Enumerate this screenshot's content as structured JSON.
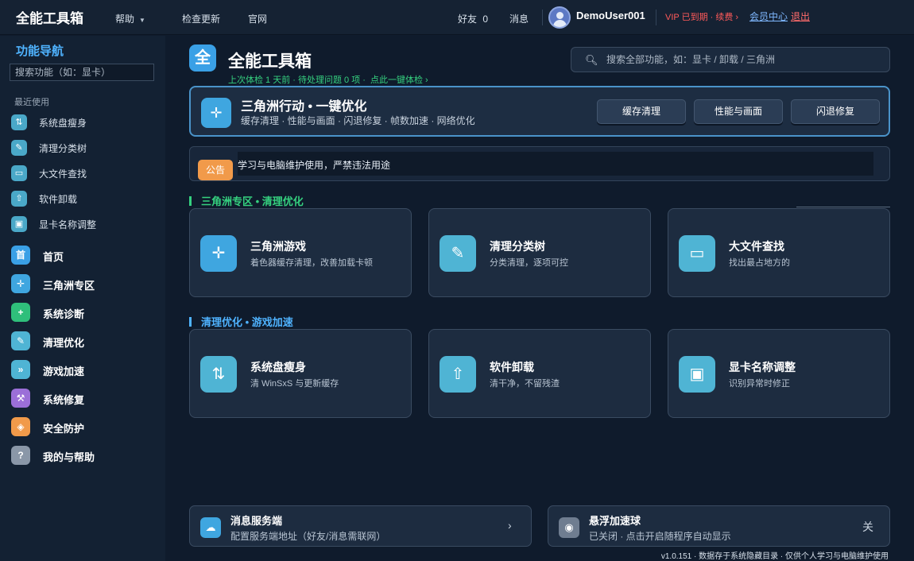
{
  "topbar": {
    "app_title": "全能工具箱",
    "menu_help": "帮助",
    "menu_check_update": "检查更新",
    "menu_official_site": "官网",
    "friends_label": "好友",
    "friends_count": "0",
    "messages_label": "消息",
    "username": "DemoUser001",
    "vip_status": "VIP 已到期 · 续费 ›",
    "member_center": "会员中心",
    "logout": "退出"
  },
  "sidebar": {
    "nav_title": "功能导航",
    "search_placeholder": "搜索功能（如：显卡）",
    "recent_label": "最近使用",
    "recent_items": [
      {
        "label": "系统盘瘦身",
        "icon": "usb-icon"
      },
      {
        "label": "清理分类树",
        "icon": "broom-icon"
      },
      {
        "label": "大文件查找",
        "icon": "folder-icon"
      },
      {
        "label": "软件卸载",
        "icon": "upload-icon"
      },
      {
        "label": "显卡名称调整",
        "icon": "gpu-icon"
      }
    ],
    "main_items": [
      {
        "label": "首页",
        "icon_text": "首",
        "color": "#3aa0e6"
      },
      {
        "label": "三角洲专区",
        "icon": "crosshair-icon",
        "color": "#3fa6e0"
      },
      {
        "label": "系统诊断",
        "icon": "plus-icon",
        "color": "#2fbf7b"
      },
      {
        "label": "清理优化",
        "icon": "broom-icon",
        "color": "#4fb4d4"
      },
      {
        "label": "游戏加速",
        "icon": "fast-forward-icon",
        "color": "#4fb4d4"
      },
      {
        "label": "系统修复",
        "icon": "wrench-icon",
        "color": "#9b6fd8"
      },
      {
        "label": "安全防护",
        "icon": "shield-icon",
        "color": "#f19a4a"
      },
      {
        "label": "我的与帮助",
        "icon": "question-icon",
        "color": "#8a97a8"
      }
    ]
  },
  "header": {
    "logo_text": "全",
    "title": "全能工具箱",
    "last_check": "上次体检 1 天前 · 待处理问题 0 项 ·",
    "check_action": "点此一键体检 ›",
    "search_placeholder": "搜索全部功能，如：显卡 / 卸载 / 三角洲"
  },
  "promo": {
    "title": "三角洲行动 • 一键优化",
    "desc": "缓存清理 · 性能与画面 · 闪退修复 · 帧数加速 · 网络优化",
    "buttons": [
      "缓存清理",
      "性能与画面",
      "闪退修复"
    ]
  },
  "notice": {
    "badge": "公告",
    "text": "学习与电脑维护使用，严禁违法用途"
  },
  "sections": [
    {
      "title": "三角洲专区 • 清理优化",
      "color": "#35d07f",
      "cards": [
        {
          "title": "三角洲游戏",
          "desc": "着色器缓存清理，改善加载卡顿",
          "icon": "crosshair-icon",
          "color": "#3fa6e0"
        },
        {
          "title": "清理分类树",
          "desc": "分类清理，逐项可控",
          "icon": "broom-icon",
          "color": "#4fb4d4"
        },
        {
          "title": "大文件查找",
          "desc": "找出最占地方的",
          "icon": "folder-icon",
          "color": "#4fb4d4"
        }
      ]
    },
    {
      "title": "清理优化 • 游戏加速",
      "color": "#4fb3ff",
      "cards": [
        {
          "title": "系统盘瘦身",
          "desc": "清 WinSxS 与更新缓存",
          "icon": "usb-icon",
          "color": "#4fb4d4"
        },
        {
          "title": "软件卸载",
          "desc": "清干净，不留残渣",
          "icon": "upload-icon",
          "color": "#4fb4d4"
        },
        {
          "title": "显卡名称调整",
          "desc": "识别异常时修正",
          "icon": "gpu-icon",
          "color": "#4fb4d4"
        }
      ]
    }
  ],
  "bottom": {
    "message_service": {
      "title": "消息服务端",
      "desc": "配置服务端地址（好友/消息需联网）",
      "icon": "cloud-icon",
      "trail": "›"
    },
    "float_ball": {
      "title": "悬浮加速球",
      "desc": "已关闭 · 点击开启随程序自动显示",
      "icon": "target-icon",
      "trail": "关"
    }
  },
  "footer": "v1.0.151 · 数据存于系统隐藏目录 · 仅供个人学习与电脑维护使用"
}
